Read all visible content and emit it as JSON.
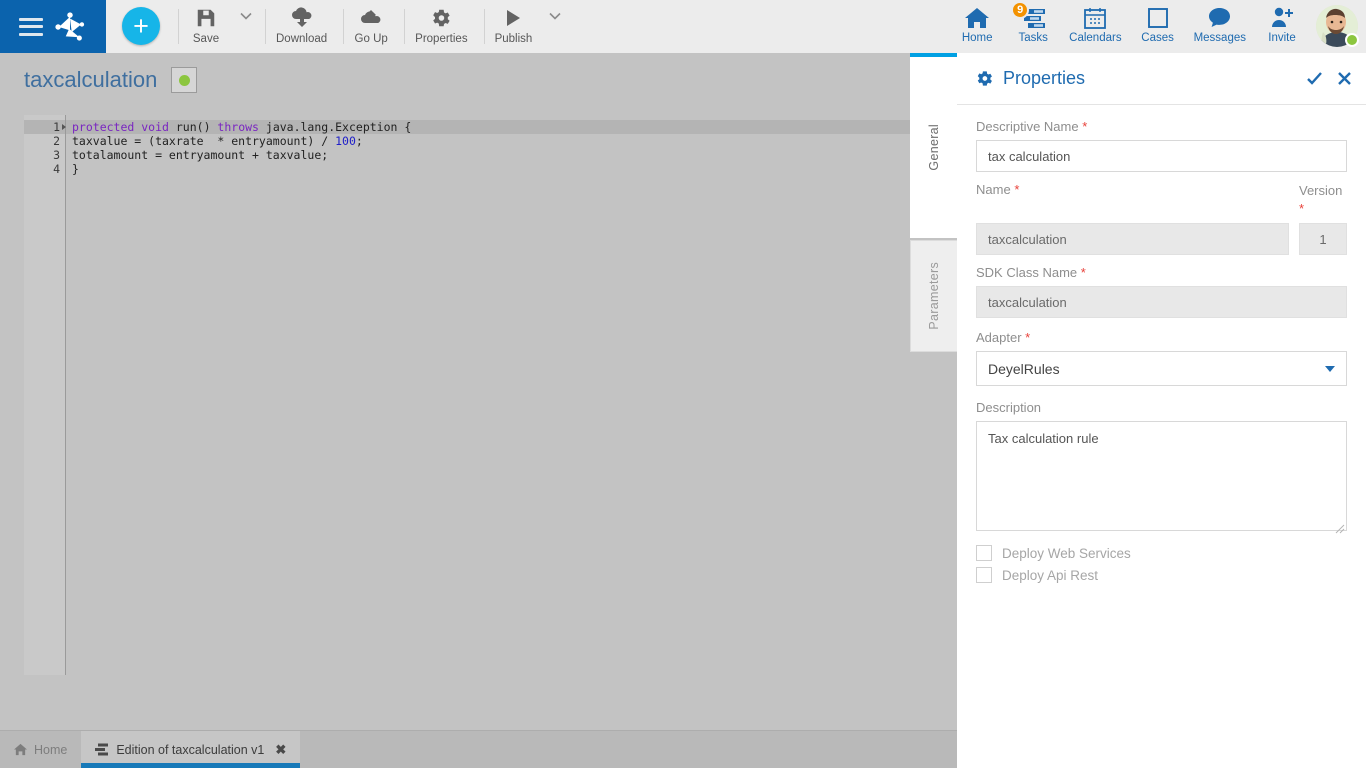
{
  "topbar": {
    "menu_icon": "hamburger-icon",
    "logo_icon": "app-logo-icon",
    "add_button_label": "+",
    "tools": [
      {
        "label": "Save",
        "icon": "save-icon",
        "has_caret": true
      },
      {
        "label": "Download",
        "icon": "download-cloud-icon",
        "has_caret": false
      },
      {
        "label": "Go Up",
        "icon": "upload-cloud-icon",
        "has_caret": false
      },
      {
        "label": "Properties",
        "icon": "gear-icon",
        "has_caret": false
      },
      {
        "label": "Publish",
        "icon": "play-icon",
        "has_caret": true
      }
    ],
    "nav": [
      {
        "label": "Home",
        "icon": "home-icon",
        "badge": ""
      },
      {
        "label": "Tasks",
        "icon": "tasks-icon",
        "badge": "9"
      },
      {
        "label": "Calendars",
        "icon": "calendar-icon",
        "badge": ""
      },
      {
        "label": "Cases",
        "icon": "case-square-icon",
        "badge": ""
      },
      {
        "label": "Messages",
        "icon": "chat-bubble-icon",
        "badge": ""
      },
      {
        "label": "Invite",
        "icon": "invite-person-icon",
        "badge": ""
      }
    ],
    "avatar": {
      "icon": "avatar",
      "status": "online"
    }
  },
  "workspace": {
    "document_title": "taxcalculation",
    "status_indicator": "green-dot",
    "editor": {
      "lines": [
        {
          "num": "1",
          "foldable": true,
          "active": true,
          "tokens": [
            {
              "t": "protected",
              "c": "k"
            },
            {
              "t": " ",
              "c": ""
            },
            {
              "t": "void",
              "c": "k"
            },
            {
              "t": " run() ",
              "c": ""
            },
            {
              "t": "throws",
              "c": "k"
            },
            {
              "t": " java.lang.Exception {",
              "c": ""
            }
          ]
        },
        {
          "num": "2",
          "foldable": false,
          "active": false,
          "tokens": [
            {
              "t": "taxvalue = (taxrate  * entryamount) / ",
              "c": ""
            },
            {
              "t": "100",
              "c": "n"
            },
            {
              "t": ";",
              "c": ""
            }
          ]
        },
        {
          "num": "3",
          "foldable": false,
          "active": false,
          "tokens": [
            {
              "t": "totalamount = entryamount + taxvalue;",
              "c": ""
            }
          ]
        },
        {
          "num": "4",
          "foldable": false,
          "active": false,
          "tokens": [
            {
              "t": "}",
              "c": ""
            }
          ]
        }
      ],
      "plain_text": "protected void run() throws java.lang.Exception {\ntaxvalue = (taxrate  * entryamount) / 100;\ntotalamount = entryamount + taxvalue;\n}"
    }
  },
  "vtabs": [
    {
      "label": "General",
      "active": true
    },
    {
      "label": "Parameters",
      "active": false
    }
  ],
  "panel": {
    "title": "Properties",
    "title_icon": "gear-icon",
    "confirm_icon": "check-icon",
    "close_icon": "close-icon",
    "fields": {
      "descriptive_name": {
        "label": "Descriptive Name",
        "required": "*",
        "value": "tax calculation",
        "disabled": false
      },
      "name": {
        "label": "Name",
        "required": "*",
        "value": "taxcalculation",
        "disabled": true
      },
      "version": {
        "label": "Version",
        "required": "*",
        "value": "1",
        "disabled": true
      },
      "sdk_class_name": {
        "label": "SDK Class Name",
        "required": "*",
        "value": "taxcalculation",
        "disabled": true
      },
      "adapter": {
        "label": "Adapter",
        "required": "*",
        "value": "DeyelRules",
        "options": [
          "DeyelRules"
        ]
      },
      "description": {
        "label": "Description",
        "required": "",
        "value": "Tax calculation rule"
      }
    },
    "checkboxes": [
      {
        "label": "Deploy Web Services",
        "checked": false
      },
      {
        "label": "Deploy Api Rest",
        "checked": false
      }
    ]
  },
  "taskbar": {
    "tabs": [
      {
        "label": "Home",
        "icon": "home-icon",
        "active": false,
        "closable": false
      },
      {
        "label": "Edition of taxcalculation v1",
        "icon": "rule-list-icon",
        "active": true,
        "closable": true,
        "close_glyph": "✖"
      }
    ]
  },
  "colors": {
    "brand_blue": "#0b63ad",
    "accent_cyan": "#00a0e3",
    "link_blue": "#1f6bb0",
    "badge_orange": "#f39200",
    "status_green": "#8cc63f",
    "required_red": "#e8413a",
    "workspace_gray": "#c3c3c3"
  }
}
